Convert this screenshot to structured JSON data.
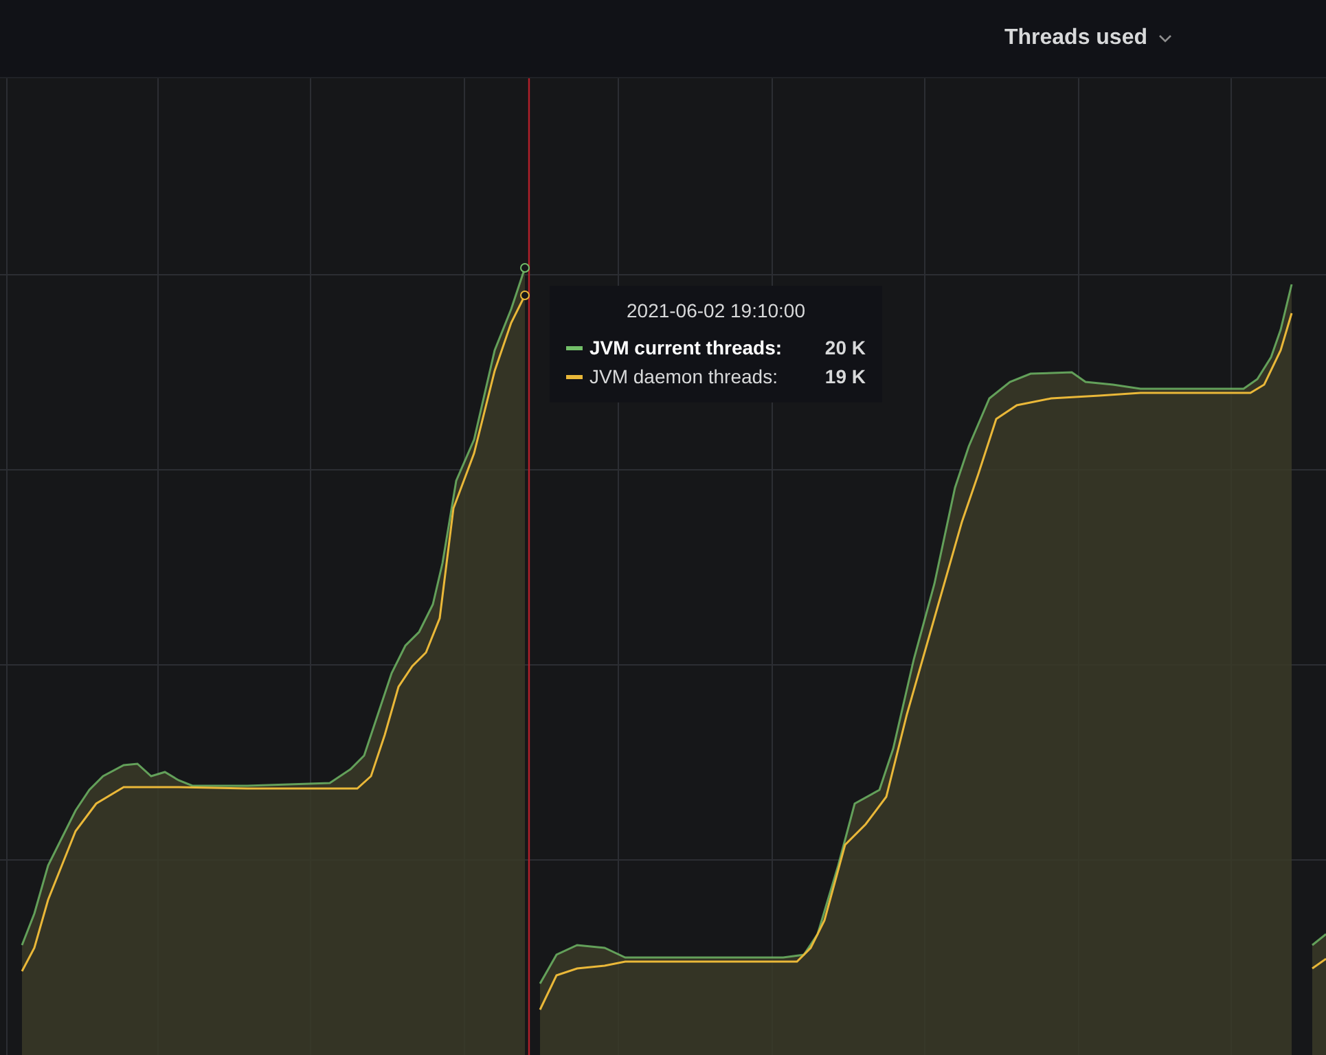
{
  "panel": {
    "title": "Threads used"
  },
  "tooltip": {
    "time": "2021-06-02 19:10:00",
    "series": [
      {
        "name": "JVM current threads:",
        "value": "20 K",
        "color": "#73bf69",
        "highlighted": true
      },
      {
        "name": "JVM daemon threads:",
        "value": "19 K",
        "color": "#eab839",
        "highlighted": false
      }
    ]
  }
}
